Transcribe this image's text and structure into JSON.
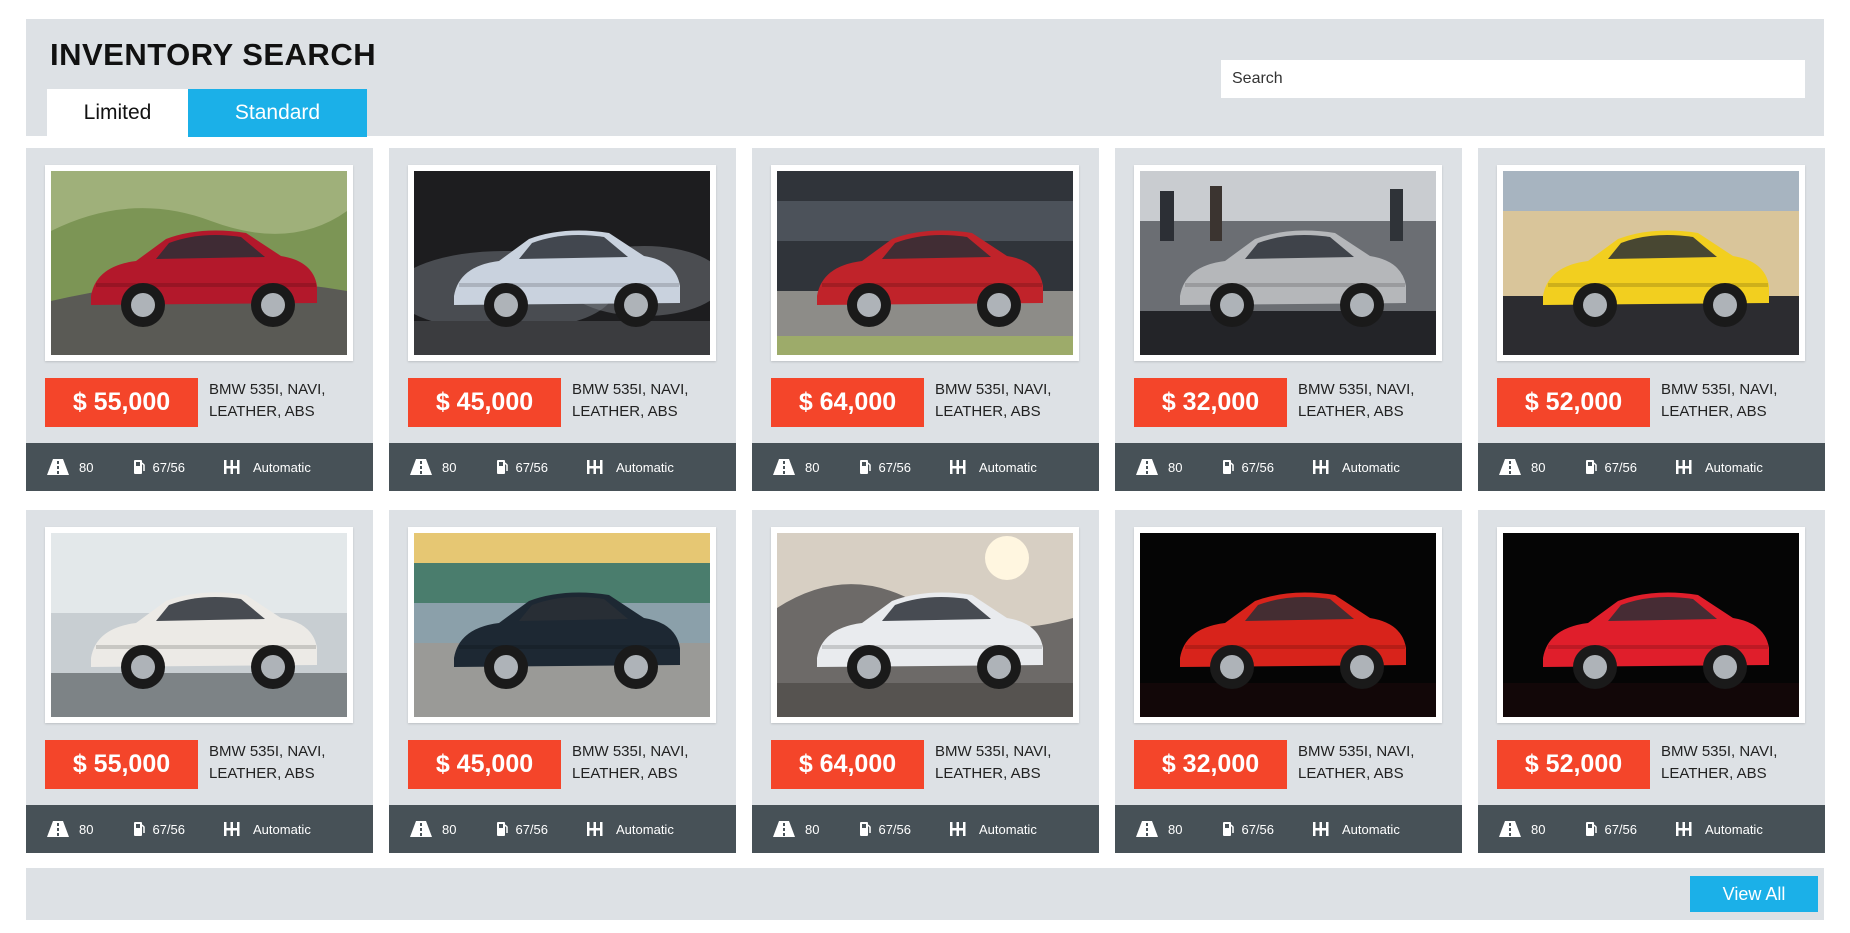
{
  "header": {
    "title": "INVENTORY SEARCH",
    "tabs": [
      {
        "label": "Limited"
      },
      {
        "label": "Standard"
      }
    ],
    "search": {
      "placeholder": "Search"
    }
  },
  "colors": {
    "accent_blue": "#1bb0e8",
    "price_red": "#f4452a",
    "panel_gray": "#dde1e5",
    "specs_bar": "#475157"
  },
  "cards": [
    {
      "price": "$ 55,000",
      "desc": "BMW 535I, NAVI, LEATHER, ABS",
      "road": "80",
      "fuel": "67/56",
      "transmission": "Automatic",
      "car_color": "#b3182b",
      "scene": "road-hills"
    },
    {
      "price": "$ 45,000",
      "desc": "BMW 535I, NAVI, LEATHER, ABS",
      "road": "80",
      "fuel": "67/56",
      "transmission": "Automatic",
      "car_color": "#c9d2de",
      "scene": "smoke-dark"
    },
    {
      "price": "$ 64,000",
      "desc": "BMW 535I, NAVI, LEATHER, ABS",
      "road": "80",
      "fuel": "67/56",
      "transmission": "Automatic",
      "car_color": "#c0232a",
      "scene": "track"
    },
    {
      "price": "$ 32,000",
      "desc": "BMW 535I, NAVI, LEATHER, ABS",
      "road": "80",
      "fuel": "67/56",
      "transmission": "Automatic",
      "car_color": "#b5b7ba",
      "scene": "showroom"
    },
    {
      "price": "$ 52,000",
      "desc": "BMW 535I, NAVI, LEATHER, ABS",
      "road": "80",
      "fuel": "67/56",
      "transmission": "Automatic",
      "car_color": "#f2cf1f",
      "scene": "showroom-light"
    },
    {
      "price": "$ 55,000",
      "desc": "BMW 535I, NAVI, LEATHER, ABS",
      "road": "80",
      "fuel": "67/56",
      "transmission": "Automatic",
      "car_color": "#eceae6",
      "scene": "showroom-white"
    },
    {
      "price": "$ 45,000",
      "desc": "BMW 535I, NAVI, LEATHER, ABS",
      "road": "80",
      "fuel": "67/56",
      "transmission": "Automatic",
      "car_color": "#1d2833",
      "scene": "parking"
    },
    {
      "price": "$ 64,000",
      "desc": "BMW 535I, NAVI, LEATHER, ABS",
      "road": "80",
      "fuel": "67/56",
      "transmission": "Automatic",
      "car_color": "#e9ebee",
      "scene": "sunset"
    },
    {
      "price": "$ 32,000",
      "desc": "BMW 535I, NAVI, LEATHER, ABS",
      "road": "80",
      "fuel": "67/56",
      "transmission": "Automatic",
      "car_color": "#d8231b",
      "scene": "black"
    },
    {
      "price": "$ 52,000",
      "desc": "BMW 535I, NAVI, LEATHER, ABS",
      "road": "80",
      "fuel": "67/56",
      "transmission": "Automatic",
      "car_color": "#e01e2b",
      "scene": "black"
    }
  ],
  "footer": {
    "view_all_label": "View All"
  }
}
